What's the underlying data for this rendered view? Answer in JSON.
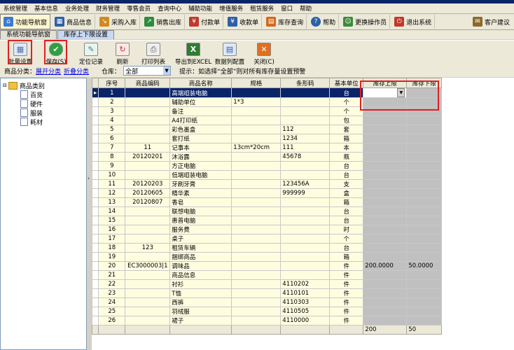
{
  "menu": [
    "系统管理",
    "基本信息",
    "业务处理",
    "财务管理",
    "零售会员",
    "查询中心",
    "辅助功能",
    "增值服务",
    "租赁服务",
    "窗口",
    "帮助"
  ],
  "toolbar": [
    {
      "label": "功能导航窗",
      "icon": "home-icon",
      "color": "#3a7bd5"
    },
    {
      "label": "商品信息",
      "icon": "grid-icon",
      "color": "#2e5fa8"
    },
    {
      "label": "采购入库",
      "icon": "cart-in-icon",
      "color": "#d08a20"
    },
    {
      "label": "销售出库",
      "icon": "cart-out-icon",
      "color": "#2e8b3d"
    },
    {
      "label": "付款单",
      "icon": "payment-icon",
      "color": "#c0392b"
    },
    {
      "label": "收款单",
      "icon": "receipt-icon",
      "color": "#2e5fa8"
    },
    {
      "label": "库存查询",
      "icon": "inventory-icon",
      "color": "#d06a20"
    },
    {
      "label": "帮助",
      "icon": "help-icon",
      "color": "#2e5fa8"
    },
    {
      "label": "更换操作员",
      "icon": "user-switch-icon",
      "color": "#3a8a3a"
    },
    {
      "label": "退出系统",
      "icon": "exit-icon",
      "color": "#c0392b"
    },
    {
      "label": "客户建议",
      "icon": "suggest-icon",
      "color": "#8a6a2a"
    }
  ],
  "tabs": [
    "系统功能导航窗",
    "库存上下限设置"
  ],
  "actions": [
    {
      "label": "批量设置",
      "icon": "batch-settings-icon",
      "glyph": "▦",
      "color": "#4a6ea8"
    },
    {
      "label": "保存(S)",
      "icon": "save-icon",
      "glyph": "✔",
      "color": "#2ea043"
    },
    {
      "label": "定位记录",
      "icon": "locate-icon",
      "glyph": "✎",
      "color": "#3a8a7a"
    },
    {
      "label": "刷新",
      "icon": "refresh-icon",
      "glyph": "↻",
      "color": "#c0392b"
    },
    {
      "label": "打印列表",
      "icon": "print-icon",
      "glyph": "⎙",
      "color": "#555555"
    },
    {
      "label": "导出到EXCEL",
      "icon": "excel-icon",
      "glyph": "X",
      "color": "#2e7d32"
    },
    {
      "label": "数据列配置",
      "icon": "columns-icon",
      "glyph": "▤",
      "color": "#2e5fa8"
    },
    {
      "label": "关闭(C)",
      "icon": "close-icon",
      "glyph": "✕",
      "color": "#e07020"
    }
  ],
  "filter": {
    "category_label": "商品分类：",
    "link_expand": "展开分类",
    "link_collapse": "折叠分类",
    "warehouse_label": "仓库：",
    "warehouse_value": "全部",
    "hint": "提示：如选择“全部”则对所有库存量设置预警"
  },
  "tree": {
    "root": "商品类别",
    "children": [
      "百货",
      "硬件",
      "服装",
      "耗材"
    ]
  },
  "columns": [
    "序号",
    "商品编码",
    "商品名称",
    "规格",
    "条形码",
    "基本单位",
    "库存上限",
    "库存下限"
  ],
  "rows": [
    [
      "1",
      "",
      "高端组装电脑",
      "",
      "",
      "台",
      "",
      ""
    ],
    [
      "2",
      "",
      "辅助单位",
      "1*3",
      "",
      "个",
      "",
      ""
    ],
    [
      "3",
      "",
      "备注",
      "",
      "",
      "个",
      "",
      ""
    ],
    [
      "4",
      "",
      "A4打印纸",
      "",
      "",
      "包",
      "",
      ""
    ],
    [
      "5",
      "",
      "彩色墨盒",
      "",
      "112",
      "套",
      "",
      ""
    ],
    [
      "6",
      "",
      "套打纸",
      "",
      "1234",
      "箱",
      "",
      ""
    ],
    [
      "7",
      "11",
      "记事本",
      "13cm*20cm",
      "111",
      "本",
      "",
      ""
    ],
    [
      "8",
      "20120201",
      "沐浴露",
      "",
      "45678",
      "瓶",
      "",
      ""
    ],
    [
      "9",
      "",
      "方正电脑",
      "",
      "",
      "台",
      "",
      ""
    ],
    [
      "10",
      "",
      "低端组装电脑",
      "",
      "",
      "台",
      "",
      ""
    ],
    [
      "11",
      "20120203",
      "牙刷牙膏",
      "",
      "123456A",
      "支",
      "",
      ""
    ],
    [
      "12",
      "20120605",
      "精华素",
      "",
      "999999",
      "盒",
      "",
      ""
    ],
    [
      "13",
      "20120807",
      "香皂",
      "",
      "",
      "箱",
      "",
      ""
    ],
    [
      "14",
      "",
      "联想电脑",
      "",
      "",
      "台",
      "",
      ""
    ],
    [
      "15",
      "",
      "惠普电脑",
      "",
      "",
      "台",
      "",
      ""
    ],
    [
      "16",
      "",
      "服务费",
      "",
      "",
      "时",
      "",
      ""
    ],
    [
      "17",
      "",
      "桌子",
      "",
      "",
      "个",
      "",
      ""
    ],
    [
      "18",
      "123",
      "租赁车辆",
      "",
      "",
      "台",
      "",
      ""
    ],
    [
      "19",
      "",
      "捆绑商品",
      "",
      "",
      "箱",
      "",
      ""
    ],
    [
      "20",
      "EC3000003|1",
      "调味品",
      "",
      "",
      "件",
      "200.0000",
      "50.0000"
    ],
    [
      "21",
      "",
      "商品信息",
      "",
      "",
      "件",
      "",
      ""
    ],
    [
      "22",
      "",
      "衬衫",
      "",
      "4110202",
      "件",
      "",
      ""
    ],
    [
      "23",
      "",
      "T恤",
      "",
      "4110101",
      "件",
      "",
      ""
    ],
    [
      "24",
      "",
      "西裤",
      "",
      "4110303",
      "件",
      "",
      ""
    ],
    [
      "25",
      "",
      "羽绒服",
      "",
      "4110505",
      "件",
      "",
      ""
    ],
    [
      "26",
      "",
      "裙子",
      "",
      "4110000",
      "件",
      "",
      ""
    ]
  ],
  "totals": {
    "upper": "200",
    "lower": "50"
  }
}
